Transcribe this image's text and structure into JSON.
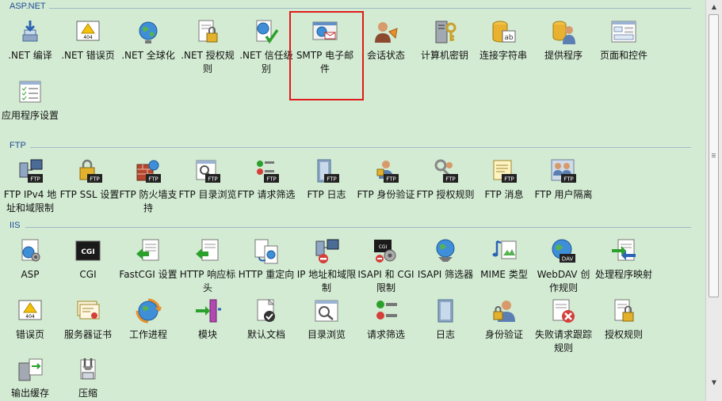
{
  "sections": [
    {
      "title": "ASP.NET",
      "items": [
        {
          "label": ".NET 编译",
          "icon": "dotnet-compile-icon"
        },
        {
          "label": ".NET 错误页",
          "icon": "dotnet-error-pages-icon"
        },
        {
          "label": ".NET 全球化",
          "icon": "dotnet-globalization-icon"
        },
        {
          "label": ".NET 授权规则",
          "icon": "dotnet-authorization-rules-icon"
        },
        {
          "label": ".NET 信任级别",
          "icon": "dotnet-trust-levels-icon"
        },
        {
          "label": "SMTP 电子邮件",
          "icon": "smtp-email-icon"
        },
        {
          "label": "会话状态",
          "icon": "session-state-icon"
        },
        {
          "label": "计算机密钥",
          "icon": "machine-key-icon"
        },
        {
          "label": "连接字符串",
          "icon": "connection-strings-icon"
        },
        {
          "label": "提供程序",
          "icon": "providers-icon"
        },
        {
          "label": "页面和控件",
          "icon": "pages-controls-icon"
        },
        {
          "label": "应用程序设置",
          "icon": "application-settings-icon"
        }
      ]
    },
    {
      "title": "FTP",
      "items": [
        {
          "label": "FTP IPv4 地址和域限制",
          "icon": "ftp-ip-restrictions-icon"
        },
        {
          "label": "FTP SSL 设置",
          "icon": "ftp-ssl-icon"
        },
        {
          "label": "FTP 防火墙支持",
          "icon": "ftp-firewall-icon"
        },
        {
          "label": "FTP 目录浏览",
          "icon": "ftp-directory-browsing-icon"
        },
        {
          "label": "FTP 请求筛选",
          "icon": "ftp-request-filtering-icon"
        },
        {
          "label": "FTP 日志",
          "icon": "ftp-logging-icon"
        },
        {
          "label": "FTP 身份验证",
          "icon": "ftp-authentication-icon"
        },
        {
          "label": "FTP 授权规则",
          "icon": "ftp-authorization-icon"
        },
        {
          "label": "FTP 消息",
          "icon": "ftp-messages-icon"
        },
        {
          "label": "FTP 用户隔离",
          "icon": "ftp-user-isolation-icon"
        }
      ]
    },
    {
      "title": "IIS",
      "items": [
        {
          "label": "ASP",
          "icon": "asp-icon"
        },
        {
          "label": "CGI",
          "icon": "cgi-icon"
        },
        {
          "label": "FastCGI 设置",
          "icon": "fastcgi-icon"
        },
        {
          "label": "HTTP 响应标头",
          "icon": "http-response-headers-icon"
        },
        {
          "label": "HTTP 重定向",
          "icon": "http-redirect-icon"
        },
        {
          "label": "IP 地址和域限制",
          "icon": "ip-restrictions-icon"
        },
        {
          "label": "ISAPI 和 CGI 限制",
          "icon": "isapi-cgi-restrictions-icon"
        },
        {
          "label": "ISAPI 筛选器",
          "icon": "isapi-filters-icon"
        },
        {
          "label": "MIME 类型",
          "icon": "mime-types-icon"
        },
        {
          "label": "WebDAV 创作规则",
          "icon": "webdav-icon"
        },
        {
          "label": "处理程序映射",
          "icon": "handler-mappings-icon"
        },
        {
          "label": "错误页",
          "icon": "error-pages-icon"
        },
        {
          "label": "服务器证书",
          "icon": "server-certificates-icon"
        },
        {
          "label": "工作进程",
          "icon": "worker-processes-icon"
        },
        {
          "label": "模块",
          "icon": "modules-icon"
        },
        {
          "label": "默认文档",
          "icon": "default-document-icon"
        },
        {
          "label": "目录浏览",
          "icon": "directory-browsing-icon"
        },
        {
          "label": "请求筛选",
          "icon": "request-filtering-icon"
        },
        {
          "label": "日志",
          "icon": "logging-icon"
        },
        {
          "label": "身份验证",
          "icon": "authentication-icon"
        },
        {
          "label": "失败请求跟踪规则",
          "icon": "failed-request-tracing-icon"
        },
        {
          "label": "授权规则",
          "icon": "authorization-rules-icon"
        },
        {
          "label": "输出缓存",
          "icon": "output-caching-icon"
        },
        {
          "label": "压缩",
          "icon": "compression-icon"
        }
      ]
    }
  ],
  "highlighted_item": "SMTP 电子邮件",
  "colors": {
    "background": "#d3ebd3",
    "section_title": "#1f4c95",
    "section_line": "#9fb9c9",
    "highlight_border": "#e11a1a",
    "scrollbar": "#eaeaea"
  }
}
